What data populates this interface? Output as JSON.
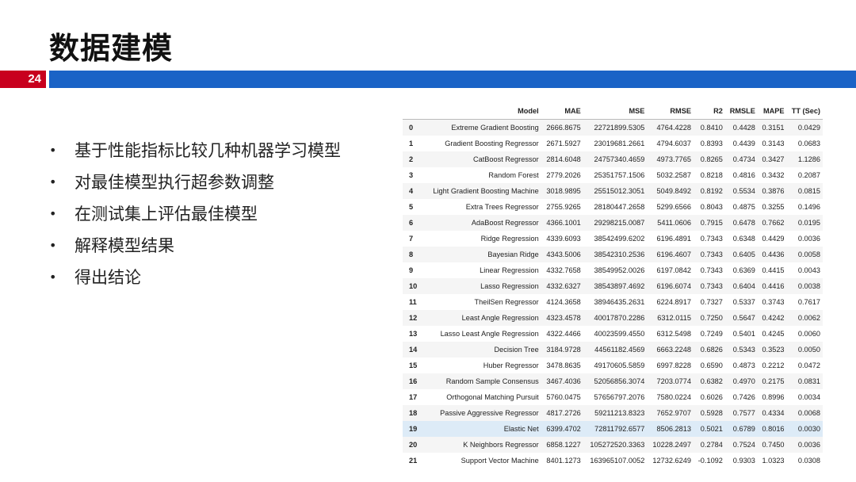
{
  "slide": {
    "title": "数据建模",
    "page_number": "24",
    "accent_red": "#c8001e",
    "accent_blue": "#1a63c6"
  },
  "bullets": [
    "基于性能指标比较几种机器学习模型",
    "对最佳模型执行超参数调整",
    "在测试集上评估最佳模型",
    "解释模型结果",
    "得出结论"
  ],
  "bullet_symbol": "•",
  "table": {
    "columns": [
      "",
      "Model",
      "MAE",
      "MSE",
      "RMSE",
      "R2",
      "RMSLE",
      "MAPE",
      "TT (Sec)"
    ],
    "highlighted_row": 19,
    "rows": [
      [
        "0",
        "Extreme Gradient Boosting",
        "2666.8675",
        "22721899.5305",
        "4764.4228",
        "0.8410",
        "0.4428",
        "0.3151",
        "0.0429"
      ],
      [
        "1",
        "Gradient Boosting Regressor",
        "2671.5927",
        "23019681.2661",
        "4794.6037",
        "0.8393",
        "0.4439",
        "0.3143",
        "0.0683"
      ],
      [
        "2",
        "CatBoost Regressor",
        "2814.6048",
        "24757340.4659",
        "4973.7765",
        "0.8265",
        "0.4734",
        "0.3427",
        "1.1286"
      ],
      [
        "3",
        "Random Forest",
        "2779.2026",
        "25351757.1506",
        "5032.2587",
        "0.8218",
        "0.4816",
        "0.3432",
        "0.2087"
      ],
      [
        "4",
        "Light Gradient Boosting Machine",
        "3018.9895",
        "25515012.3051",
        "5049.8492",
        "0.8192",
        "0.5534",
        "0.3876",
        "0.0815"
      ],
      [
        "5",
        "Extra Trees Regressor",
        "2755.9265",
        "28180447.2658",
        "5299.6566",
        "0.8043",
        "0.4875",
        "0.3255",
        "0.1496"
      ],
      [
        "6",
        "AdaBoost Regressor",
        "4366.1001",
        "29298215.0087",
        "5411.0606",
        "0.7915",
        "0.6478",
        "0.7662",
        "0.0195"
      ],
      [
        "7",
        "Ridge Regression",
        "4339.6093",
        "38542499.6202",
        "6196.4891",
        "0.7343",
        "0.6348",
        "0.4429",
        "0.0036"
      ],
      [
        "8",
        "Bayesian Ridge",
        "4343.5006",
        "38542310.2536",
        "6196.4607",
        "0.7343",
        "0.6405",
        "0.4436",
        "0.0058"
      ],
      [
        "9",
        "Linear Regression",
        "4332.7658",
        "38549952.0026",
        "6197.0842",
        "0.7343",
        "0.6369",
        "0.4415",
        "0.0043"
      ],
      [
        "10",
        "Lasso Regression",
        "4332.6327",
        "38543897.4692",
        "6196.6074",
        "0.7343",
        "0.6404",
        "0.4416",
        "0.0038"
      ],
      [
        "11",
        "TheilSen Regressor",
        "4124.3658",
        "38946435.2631",
        "6224.8917",
        "0.7327",
        "0.5337",
        "0.3743",
        "0.7617"
      ],
      [
        "12",
        "Least Angle Regression",
        "4323.4578",
        "40017870.2286",
        "6312.0115",
        "0.7250",
        "0.5647",
        "0.4242",
        "0.0062"
      ],
      [
        "13",
        "Lasso Least Angle Regression",
        "4322.4466",
        "40023599.4550",
        "6312.5498",
        "0.7249",
        "0.5401",
        "0.4245",
        "0.0060"
      ],
      [
        "14",
        "Decision Tree",
        "3184.9728",
        "44561182.4569",
        "6663.2248",
        "0.6826",
        "0.5343",
        "0.3523",
        "0.0050"
      ],
      [
        "15",
        "Huber Regressor",
        "3478.8635",
        "49170605.5859",
        "6997.8228",
        "0.6590",
        "0.4873",
        "0.2212",
        "0.0472"
      ],
      [
        "16",
        "Random Sample Consensus",
        "3467.4036",
        "52056856.3074",
        "7203.0774",
        "0.6382",
        "0.4970",
        "0.2175",
        "0.0831"
      ],
      [
        "17",
        "Orthogonal Matching Pursuit",
        "5760.0475",
        "57656797.2076",
        "7580.0224",
        "0.6026",
        "0.7426",
        "0.8996",
        "0.0034"
      ],
      [
        "18",
        "Passive Aggressive Regressor",
        "4817.2726",
        "59211213.8323",
        "7652.9707",
        "0.5928",
        "0.7577",
        "0.4334",
        "0.0068"
      ],
      [
        "19",
        "Elastic Net",
        "6399.4702",
        "72811792.6577",
        "8506.2813",
        "0.5021",
        "0.6789",
        "0.8016",
        "0.0030"
      ],
      [
        "20",
        "K Neighbors Regressor",
        "6858.1227",
        "105272520.3363",
        "10228.2497",
        "0.2784",
        "0.7524",
        "0.7450",
        "0.0036"
      ],
      [
        "21",
        "Support Vector Machine",
        "8401.1273",
        "163965107.0052",
        "12732.6249",
        "-0.1092",
        "0.9303",
        "1.0323",
        "0.0308"
      ]
    ]
  }
}
